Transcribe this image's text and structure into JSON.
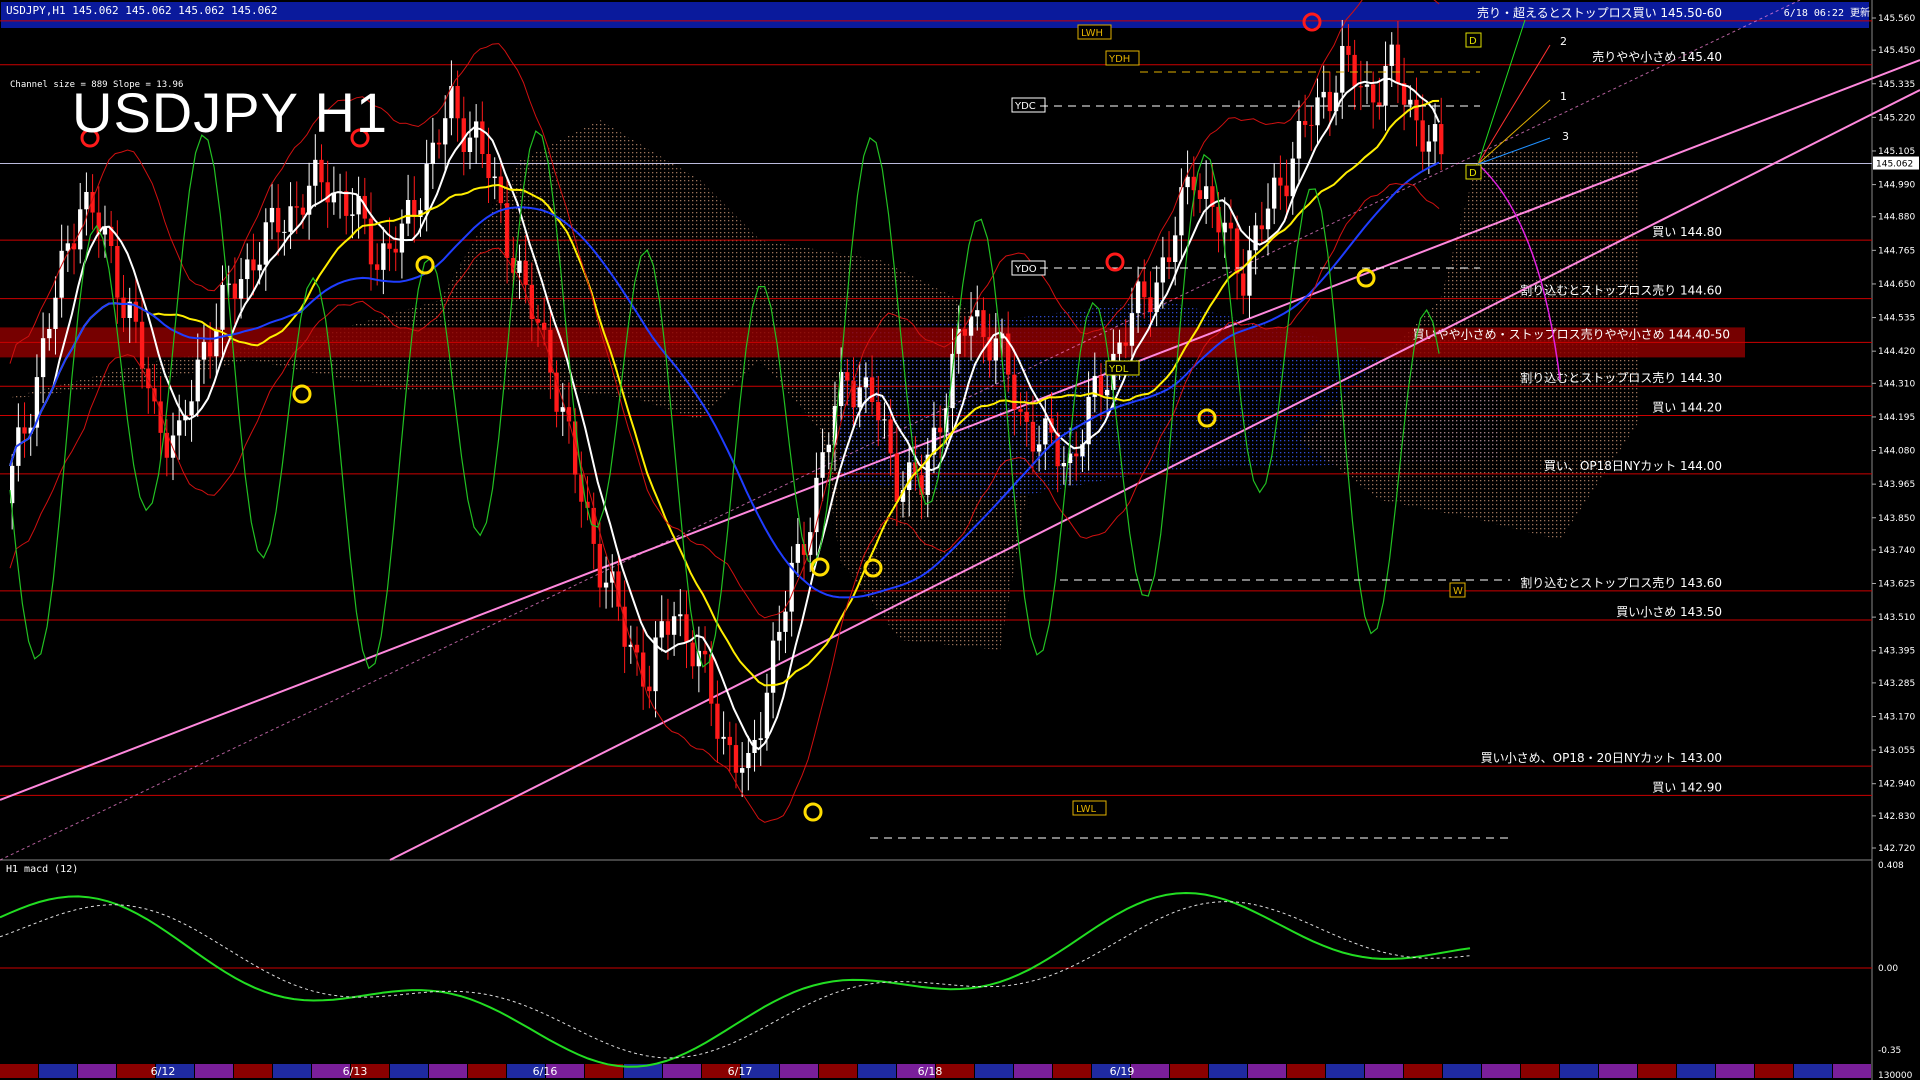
{
  "header": {
    "symbol_info": "USDJPY,H1  145.062 145.062 145.062 145.062",
    "timestamp": "6/18 06:22 更新"
  },
  "chart_title": "USDJPY H1",
  "channel_info": "Channel size = 889 Slope = 13.96",
  "subchart_label": "H1  macd (12)",
  "colors": {
    "bg": "#000000",
    "title_band": "#0a1a9c",
    "level_line": "#cc0000",
    "pink_channel": "#ff88dd",
    "white_ma": "#ffffff",
    "yellow_ma": "#ffee00",
    "blue_ma": "#1f3dff",
    "green_osc": "#22c022",
    "cloud": "#b5866a"
  },
  "chart_data": {
    "type": "candlestick",
    "ylim": [
      142.72,
      145.56
    ],
    "y_ticks": [
      "145.560",
      "145.450",
      "145.335",
      "145.220",
      "145.105",
      "144.990",
      "144.880",
      "144.765",
      "144.650",
      "144.535",
      "144.420",
      "144.310",
      "144.195",
      "144.080",
      "143.965",
      "143.850",
      "143.740",
      "143.625",
      "143.510",
      "143.395",
      "143.285",
      "143.170",
      "143.055",
      "142.940",
      "142.830",
      "142.720"
    ],
    "current_price": "145.062",
    "x_labels": [
      "6/12",
      "6/13",
      "6/16",
      "6/17",
      "6/18",
      "6/19"
    ],
    "macd_ticks": [
      "0.408",
      "0.00",
      "-0.35"
    ],
    "macd_bottom_tick": "130000",
    "price_path": [
      143.9,
      144.25,
      144.6,
      144.95,
      144.8,
      144.55,
      144.2,
      144.1,
      144.45,
      144.6,
      144.75,
      144.85,
      144.95,
      145.0,
      144.9,
      144.75,
      144.8,
      145.05,
      145.25,
      145.15,
      144.9,
      144.6,
      144.4,
      144.0,
      143.7,
      143.45,
      143.3,
      143.55,
      143.35,
      143.1,
      142.95,
      143.4,
      143.7,
      144.05,
      144.35,
      144.25,
      144.0,
      143.95,
      144.3,
      144.55,
      144.45,
      144.2,
      144.1,
      144.05,
      144.25,
      144.45,
      144.6,
      144.75,
      145.05,
      144.85,
      144.7,
      144.9,
      145.1,
      145.25,
      145.4,
      145.3,
      145.38,
      145.22,
      145.06
    ],
    "levels": [
      {
        "price": 145.55,
        "label": "売り・超えるとストップロス買い 145.50-60",
        "highlight": true
      },
      {
        "price": 145.4,
        "label": "売りやや小さめ 145.40"
      },
      {
        "price": 144.8,
        "label": "買い 144.80"
      },
      {
        "price": 144.6,
        "label": "割り込むとストップロス売り 144.60"
      },
      {
        "price": 144.45,
        "label": "買いやや小さめ・ストップロス売りやや小さめ 144.40-50",
        "band": true
      },
      {
        "price": 144.3,
        "label": "割り込むとストップロス売り 144.30"
      },
      {
        "price": 144.2,
        "label": "買い 144.20"
      },
      {
        "price": 144.0,
        "label": "買い、OP18日NYカット 144.00"
      },
      {
        "price": 143.6,
        "label": "割り込むとストップロス売り 143.60"
      },
      {
        "price": 143.5,
        "label": "買い小さめ 143.50"
      },
      {
        "price": 143.0,
        "label": "買い小さめ、OP18・20日NYカット 143.00"
      },
      {
        "price": 142.9,
        "label": "買い 142.90"
      }
    ],
    "tags": [
      "LWH",
      "YDH",
      "YDC",
      "YDO",
      "YDL",
      "LWL",
      "D",
      "D",
      "W"
    ],
    "fan_labels": [
      "1",
      "2",
      "3"
    ]
  }
}
